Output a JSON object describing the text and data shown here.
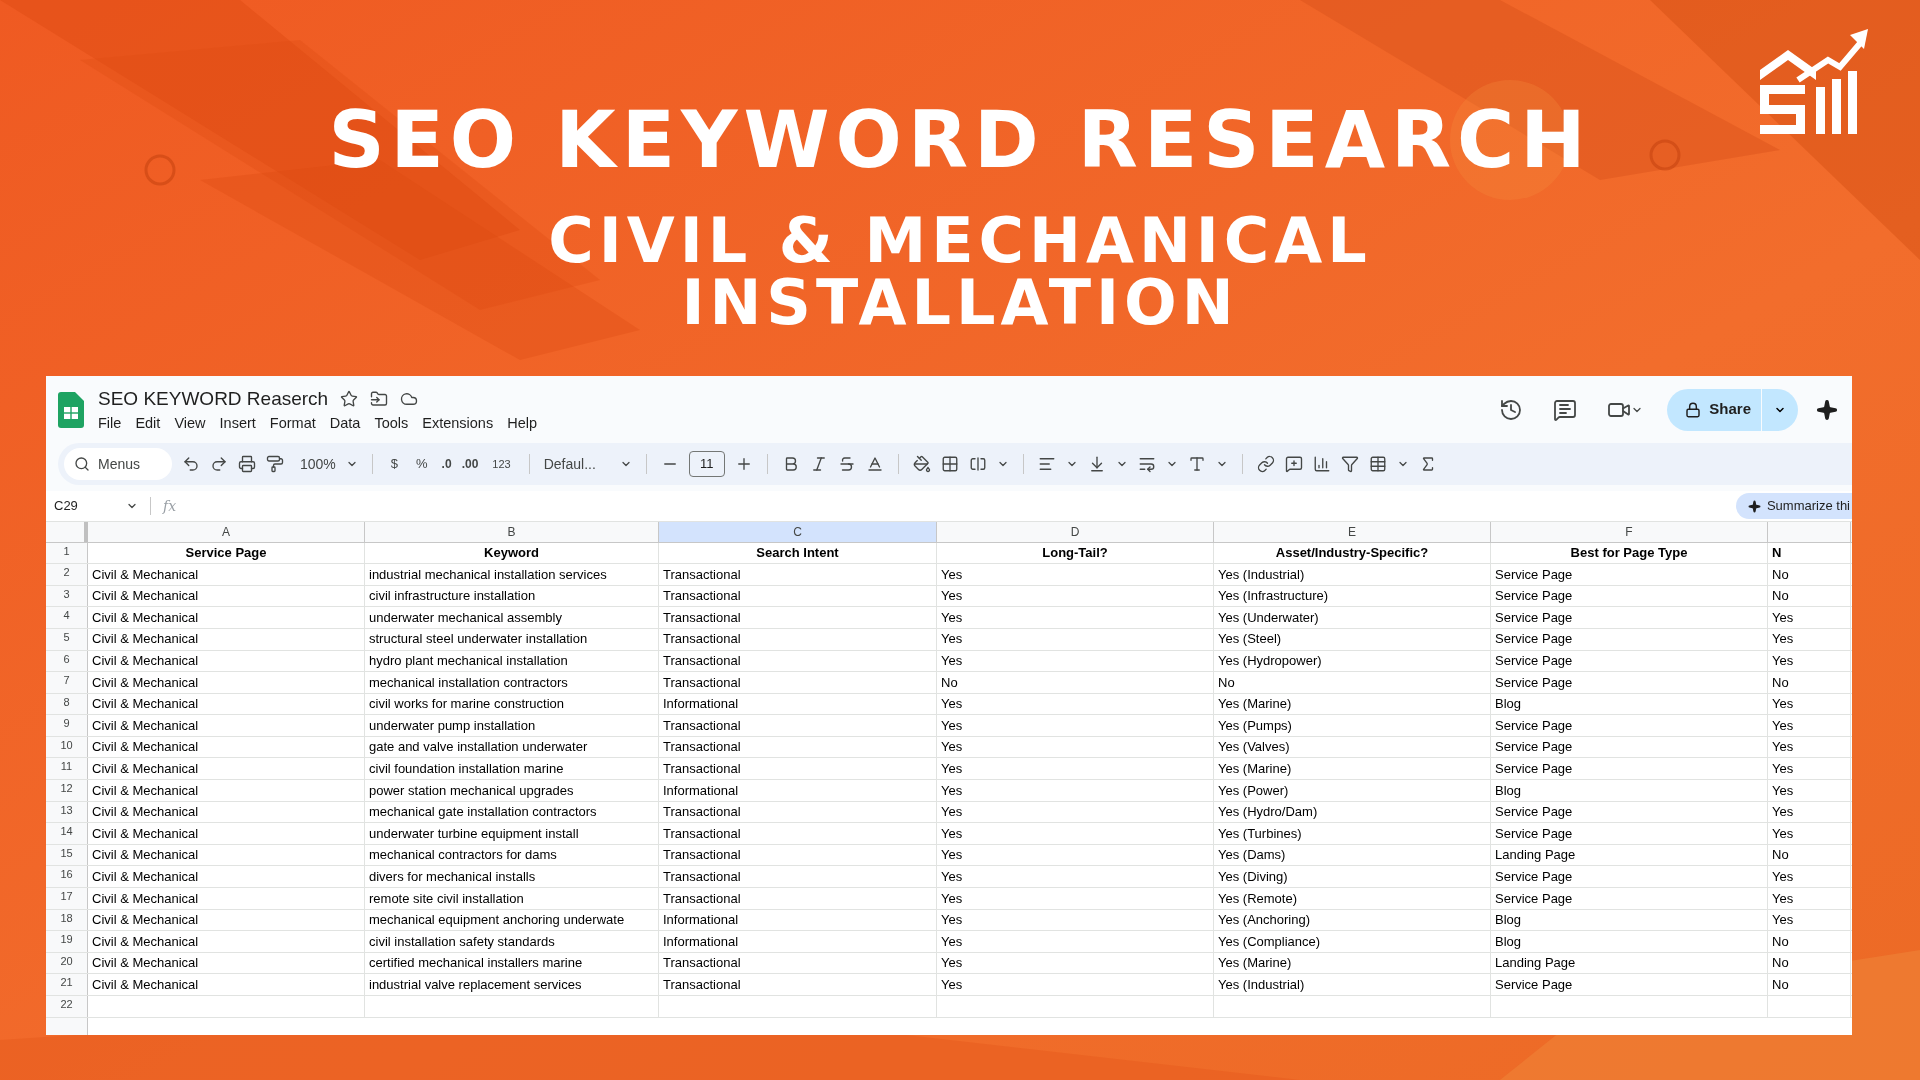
{
  "banner": {
    "title": "SEO KEYWORD RESEARCH",
    "subtitle_lines": [
      "CIVIL & MECHANICAL",
      "INSTALLATION"
    ]
  },
  "sheet": {
    "doc_title": "SEO KEYWORD Reaserch",
    "menu": [
      "File",
      "Edit",
      "View",
      "Insert",
      "Format",
      "Data",
      "Tools",
      "Extensions",
      "Help"
    ],
    "share": "Share",
    "toolbar": {
      "search_placeholder": "Menus",
      "zoom": "100%",
      "currency": "$",
      "percent": "%",
      "decrease_decimals": ".0",
      "increase_decimals": ".00",
      "number_format": "123",
      "font": "Defaul...",
      "font_size": "11"
    },
    "name_box": "C29",
    "formula_label": "fx",
    "summarize": "Summarize thi",
    "columns": [
      {
        "letter": "A",
        "selected": false
      },
      {
        "letter": "B",
        "selected": false
      },
      {
        "letter": "C",
        "selected": true
      },
      {
        "letter": "D",
        "selected": false
      },
      {
        "letter": "E",
        "selected": false
      },
      {
        "letter": "F",
        "selected": false
      }
    ],
    "rows": [
      {
        "number": "1",
        "kind": "header",
        "cells": [
          "Service Page",
          "Keyword",
          "Search Intent",
          "Long-Tail?",
          "Asset/Industry-Specific?",
          "Best for Page Type",
          "N"
        ]
      },
      {
        "number": "2",
        "kind": "data",
        "cells": [
          "Civil & Mechanical",
          "industrial mechanical installation services",
          "Transactional",
          "Yes",
          "Yes (Industrial)",
          "Service Page",
          "No"
        ]
      },
      {
        "number": "3",
        "kind": "data",
        "cells": [
          "Civil & Mechanical",
          "civil infrastructure installation",
          "Transactional",
          "Yes",
          "Yes (Infrastructure)",
          "Service Page",
          "No"
        ]
      },
      {
        "number": "4",
        "kind": "data",
        "cells": [
          "Civil & Mechanical",
          "underwater mechanical assembly",
          "Transactional",
          "Yes",
          "Yes (Underwater)",
          "Service Page",
          "Yes"
        ]
      },
      {
        "number": "5",
        "kind": "data",
        "cells": [
          "Civil & Mechanical",
          "structural steel underwater installation",
          "Transactional",
          "Yes",
          "Yes (Steel)",
          "Service Page",
          "Yes"
        ]
      },
      {
        "number": "6",
        "kind": "data",
        "cells": [
          "Civil & Mechanical",
          "hydro plant mechanical installation",
          "Transactional",
          "Yes",
          "Yes (Hydropower)",
          "Service Page",
          "Yes"
        ]
      },
      {
        "number": "7",
        "kind": "data",
        "cells": [
          "Civil & Mechanical",
          "mechanical installation contractors",
          "Transactional",
          "No",
          "No",
          "Service Page",
          "No"
        ]
      },
      {
        "number": "8",
        "kind": "data",
        "cells": [
          "Civil & Mechanical",
          "civil works for marine construction",
          "Informational",
          "Yes",
          "Yes (Marine)",
          "Blog",
          "Yes"
        ]
      },
      {
        "number": "9",
        "kind": "data",
        "cells": [
          "Civil & Mechanical",
          "underwater pump installation",
          "Transactional",
          "Yes",
          "Yes (Pumps)",
          "Service Page",
          "Yes"
        ]
      },
      {
        "number": "10",
        "kind": "data",
        "cells": [
          "Civil & Mechanical",
          "gate and valve installation underwater",
          "Transactional",
          "Yes",
          "Yes (Valves)",
          "Service Page",
          "Yes"
        ]
      },
      {
        "number": "11",
        "kind": "data",
        "cells": [
          "Civil & Mechanical",
          "civil foundation installation marine",
          "Transactional",
          "Yes",
          "Yes (Marine)",
          "Service Page",
          "Yes"
        ]
      },
      {
        "number": "12",
        "kind": "data",
        "cells": [
          "Civil & Mechanical",
          "power station mechanical upgrades",
          "Informational",
          "Yes",
          "Yes (Power)",
          "Blog",
          "Yes"
        ]
      },
      {
        "number": "13",
        "kind": "data",
        "cells": [
          "Civil & Mechanical",
          "mechanical gate installation contractors",
          "Transactional",
          "Yes",
          "Yes (Hydro/Dam)",
          "Service Page",
          "Yes"
        ]
      },
      {
        "number": "14",
        "kind": "data",
        "cells": [
          "Civil & Mechanical",
          "underwater turbine equipment install",
          "Transactional",
          "Yes",
          "Yes (Turbines)",
          "Service Page",
          "Yes"
        ]
      },
      {
        "number": "15",
        "kind": "data",
        "cells": [
          "Civil & Mechanical",
          "mechanical contractors for dams",
          "Transactional",
          "Yes",
          "Yes (Dams)",
          "Landing Page",
          "No"
        ]
      },
      {
        "number": "16",
        "kind": "data",
        "cells": [
          "Civil & Mechanical",
          "divers for mechanical installs",
          "Transactional",
          "Yes",
          "Yes (Diving)",
          "Service Page",
          "Yes"
        ]
      },
      {
        "number": "17",
        "kind": "data",
        "cells": [
          "Civil & Mechanical",
          "remote site civil installation",
          "Transactional",
          "Yes",
          "Yes (Remote)",
          "Service Page",
          "Yes"
        ]
      },
      {
        "number": "18",
        "kind": "data",
        "cells": [
          "Civil & Mechanical",
          "mechanical equipment anchoring underwate",
          "Informational",
          "Yes",
          "Yes (Anchoring)",
          "Blog",
          "Yes"
        ]
      },
      {
        "number": "19",
        "kind": "data",
        "cells": [
          "Civil & Mechanical",
          "civil installation safety standards",
          "Informational",
          "Yes",
          "Yes (Compliance)",
          "Blog",
          "No"
        ]
      },
      {
        "number": "20",
        "kind": "data",
        "cells": [
          "Civil & Mechanical",
          "certified mechanical installers marine",
          "Transactional",
          "Yes",
          "Yes (Marine)",
          "Landing Page",
          "No"
        ]
      },
      {
        "number": "21",
        "kind": "data",
        "cells": [
          "Civil & Mechanical",
          "industrial valve replacement services",
          "Transactional",
          "Yes",
          "Yes (Industrial)",
          "Service Page",
          "No"
        ]
      },
      {
        "number": "22",
        "kind": "data"
      }
    ]
  }
}
